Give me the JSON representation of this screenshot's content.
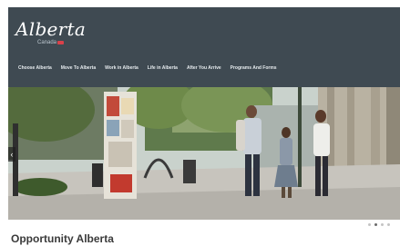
{
  "header": {
    "logo_text": "Alberta",
    "logo_subtext": "Canada"
  },
  "nav": {
    "items": [
      {
        "label": "Choose Alberta"
      },
      {
        "label": "Move To Alberta"
      },
      {
        "label": "Work in Alberta"
      },
      {
        "label": "Life in Alberta"
      },
      {
        "label": "After You Arrive"
      },
      {
        "label": "Programs And Forms"
      }
    ]
  },
  "hero": {
    "image": "street-scene-family-walking-photo",
    "prev_icon": "chevron-left-icon",
    "prev_glyph": "‹"
  },
  "carousel": {
    "slide_count": 4,
    "active_index": 1
  },
  "main": {
    "title": "Opportunity Alberta"
  },
  "colors": {
    "header_bg": "#3f4a52",
    "nav_text": "#e6ebee",
    "flag_red": "#d9414a"
  }
}
